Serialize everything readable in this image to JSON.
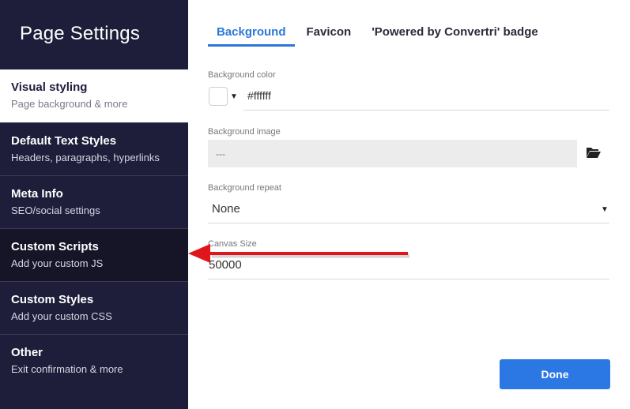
{
  "sidebar": {
    "title": "Page Settings",
    "items": [
      {
        "label": "Visual styling",
        "sub": "Page background & more"
      },
      {
        "label": "Default Text Styles",
        "sub": "Headers, paragraphs, hyperlinks"
      },
      {
        "label": "Meta Info",
        "sub": "SEO/social settings"
      },
      {
        "label": "Custom Scripts",
        "sub": "Add your custom JS"
      },
      {
        "label": "Custom Styles",
        "sub": "Add your custom CSS"
      },
      {
        "label": "Other",
        "sub": "Exit confirmation & more"
      }
    ]
  },
  "tabs": [
    "Background",
    "Favicon",
    "'Powered by Convertri' badge"
  ],
  "form": {
    "bg_color_label": "Background color",
    "bg_color_value": "#ffffff",
    "bg_image_label": "Background image",
    "bg_image_placeholder": "---",
    "bg_repeat_label": "Background repeat",
    "bg_repeat_value": "None",
    "canvas_label": "Canvas Size",
    "canvas_value": "50000"
  },
  "done_label": "Done",
  "colors": {
    "sidebar_bg": "#1f1e3a",
    "accent": "#2d77d9",
    "done_button": "#2b78e4",
    "arrow": "#e0161b"
  }
}
